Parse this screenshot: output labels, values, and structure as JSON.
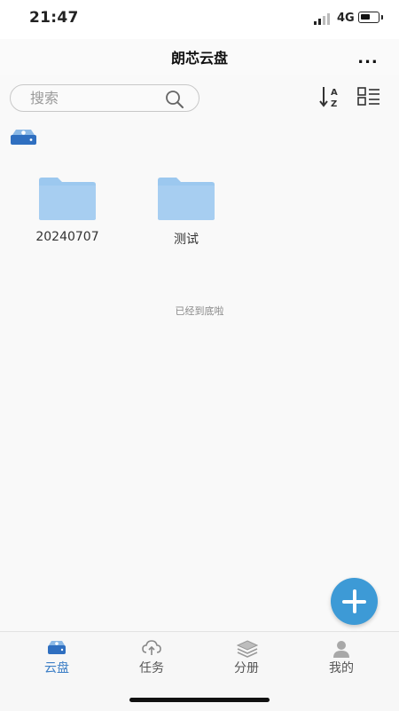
{
  "status_bar": {
    "time": "21:47",
    "network": "4G",
    "battery_level": 0.6
  },
  "header": {
    "title": "朗芯云盘",
    "more_label": "..."
  },
  "toolbar": {
    "search_placeholder": "搜索"
  },
  "folders": [
    {
      "name": "20240707"
    },
    {
      "name": "测试"
    }
  ],
  "list_end_text": "已经到底啦",
  "nav": {
    "items": [
      {
        "label": "云盘",
        "icon": "cloud-drive-icon",
        "active": true
      },
      {
        "label": "任务",
        "icon": "cloud-upload-icon",
        "active": false
      },
      {
        "label": "分册",
        "icon": "layers-icon",
        "active": false
      },
      {
        "label": "我的",
        "icon": "person-icon",
        "active": false
      }
    ]
  },
  "colors": {
    "accent": "#3d9ad6",
    "folder": "#9cc8ef",
    "active_nav": "#3d7fc6"
  }
}
